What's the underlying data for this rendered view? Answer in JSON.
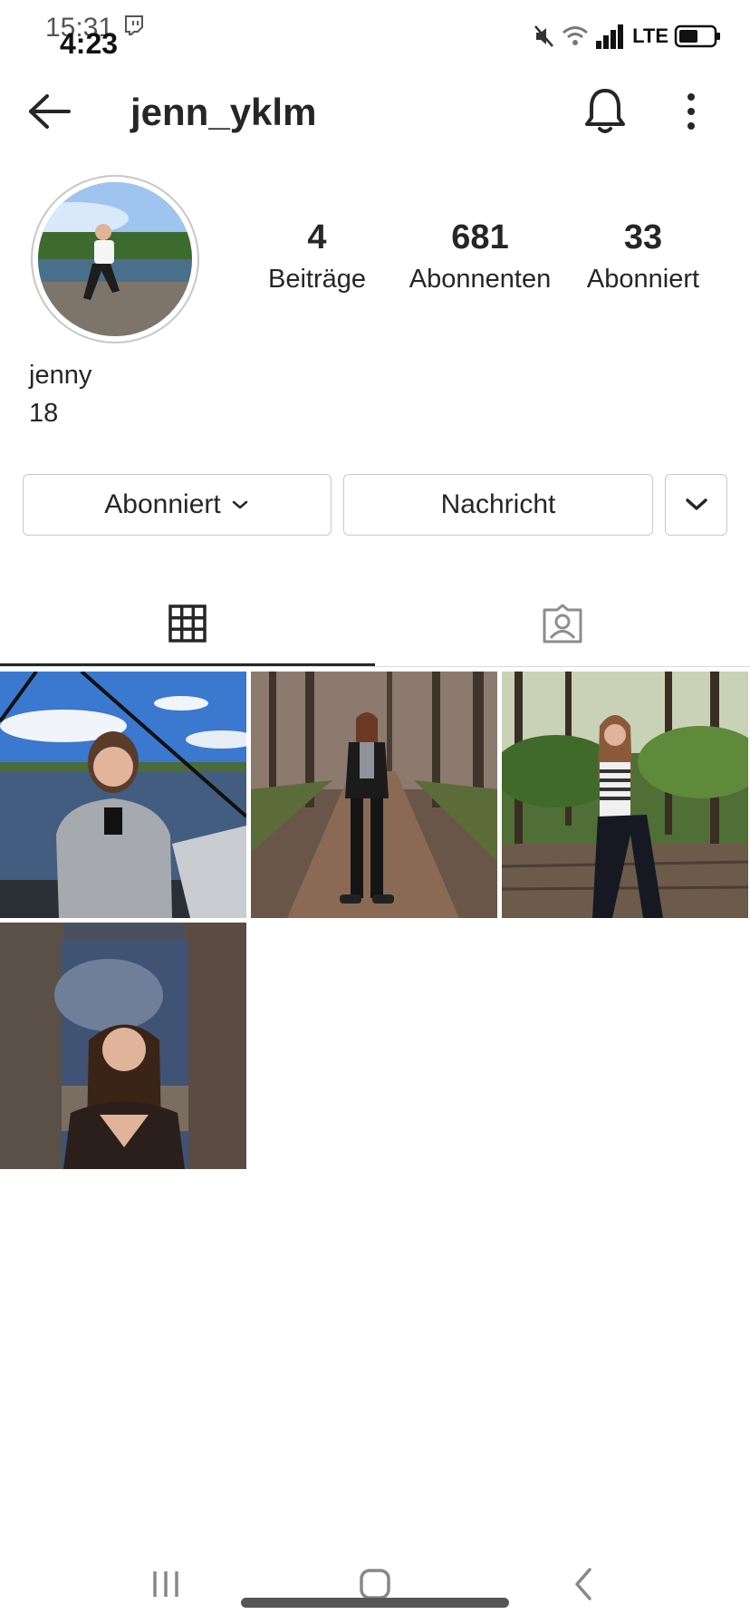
{
  "status_bar": {
    "time_background": "15:31",
    "time": "4:23",
    "network": "LTE",
    "icons": [
      "twitch-icon",
      "mute-icon",
      "wifi-icon",
      "signal-icon",
      "battery-icon"
    ]
  },
  "header": {
    "username": "jenn_yklm",
    "icons": [
      "back-arrow-icon",
      "bell-icon",
      "more-vertical-icon"
    ]
  },
  "profile": {
    "name": "jenny",
    "bio": "18",
    "stats": [
      {
        "value": "4",
        "label": "Beiträge"
      },
      {
        "value": "681",
        "label": "Abonnenten"
      },
      {
        "value": "33",
        "label": "Abonniert"
      }
    ]
  },
  "actions": {
    "follow_label": "Abonniert",
    "message_label": "Nachricht"
  },
  "tabs": [
    {
      "icon": "grid-icon",
      "active": true
    },
    {
      "icon": "tagged-person-icon",
      "active": false
    }
  ],
  "posts": [
    {
      "description": "boat-lake-photo"
    },
    {
      "description": "forest-path-photo"
    },
    {
      "description": "forest-log-photo"
    },
    {
      "description": "portrait-photo"
    }
  ],
  "colors": {
    "text": "#262626",
    "border": "#c8c8c8",
    "divider": "#dbdbdb"
  }
}
